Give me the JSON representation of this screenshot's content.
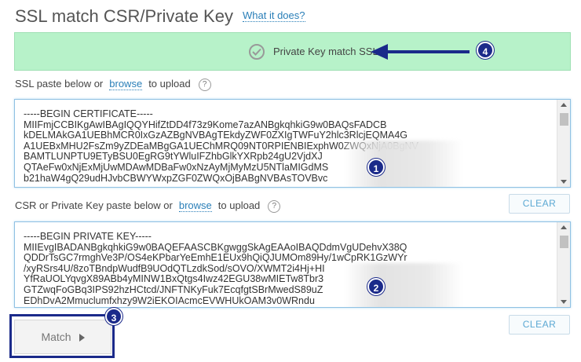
{
  "header": {
    "title": "SSL match CSR/Private Key",
    "help_link": "What it does?"
  },
  "result": {
    "message": "Private Key match SSL",
    "status_color": "#b7f2c9",
    "icon": "check-circle-icon"
  },
  "ssl_section": {
    "label_before": "SSL paste below or",
    "upload_link": "browse",
    "label_after": "to upload",
    "help_icon": "?",
    "content": "-----BEGIN CERTIFICATE-----\nMIIFmjCCBIKgAwIBAgIQQYHifZtDD4f73z9Kome7azANBgkqhkiG9w0BAQsFADCB\nkDELMAkGA1UEBhMCR0IxGzAZBgNVBAgTEkdyZWF0ZXIgTWFuY2hlc3RlcjEQMA4G\nA1UEBxMHU2FsZm9yZDEaMBgGA1UEChMRQ09NT0RPIENBIExphW0ZWQxNjA0BgNV\nBAMTLUNPTU9ETyBSU0EgRG9tYWluIFZhbGlkYXRpb24gU2VjdXJ\nQTAeFw0xNjExMjUwMDAwMDBaFw0xNzAyMjMyMzU5NTlaMIGdMS\nb21haW4gQ29udHJvbCBWYWxpZGF0ZWQxOjBABgNVBAsTOVBvc"
  },
  "csr_section": {
    "label_before": "CSR or Private Key paste below or",
    "upload_link": "browse",
    "label_after": "to upload",
    "help_icon": "?",
    "content": "-----BEGIN PRIVATE KEY-----\nMIIEvgIBADANBgkqhkiG9w0BAQEFAASCBKgwggSkAgEAAoIBAQDdmVgUDehvX38Q\nQDDrTsGC7rmghVe3P/OS4eKPbarYeEmhE1EUx9hQiQJUMOm89Hy/1wCpRK1GzWYr\n/xyRSrs4U/8zoTBndpWudfB9UOdQTLzdkSod/sOVO/XWMT2i4Hj+HI\nYfRaUOLYqvgX89ABb4yMINW1BxQtgs4Iwz42EGU38wMIETw8Tbr3\nGTZwqFoGBq3IPS92hzHCtcd/JNFTNKyFuk7EcqfgtSBrMwedS89uZ\nEDhDvA2Mmuclumfxhzy9W2iEKOIAcmcEVWHUkOAM3v0WRndu"
  },
  "buttons": {
    "clear_label": "CLEAR",
    "match_label": "Match"
  },
  "annotations": {
    "step1": "1",
    "step2": "2",
    "step3": "3",
    "step4": "4",
    "color": "#1b2a8a"
  }
}
